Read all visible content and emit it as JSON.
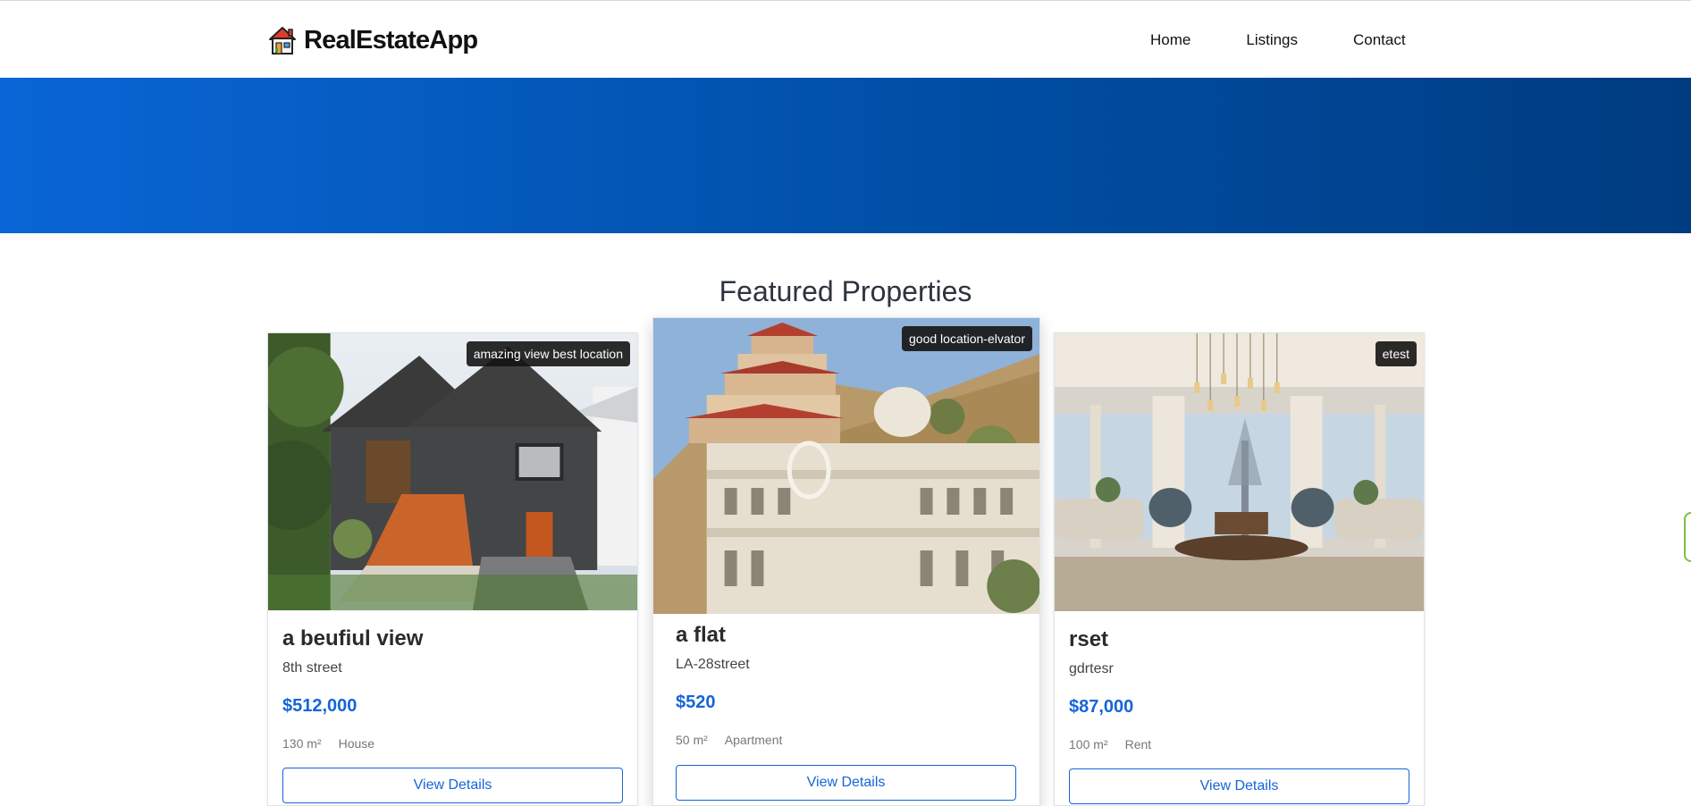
{
  "header": {
    "brand_icon": "house-icon",
    "brand_name": "RealEstateApp",
    "nav": [
      {
        "label": "Home"
      },
      {
        "label": "Listings"
      },
      {
        "label": "Contact"
      }
    ]
  },
  "colors": {
    "primary": "#1565d8",
    "hero_start": "#0a66d6",
    "hero_end": "#003c80"
  },
  "featured": {
    "title": "Featured Properties",
    "properties": [
      {
        "tag": "amazing view best location",
        "title": "a beufiul view",
        "address": "8th street",
        "price": "$512,000",
        "area": "130 m²",
        "type": "House",
        "button": "View Details"
      },
      {
        "tag": "good location-elvator",
        "title": "a flat",
        "address": "LA-28street",
        "price": "$520",
        "area": "50 m²",
        "type": "Apartment",
        "button": "View Details"
      },
      {
        "tag": "etest",
        "title": "rset",
        "address": "gdrtesr",
        "price": "$87,000",
        "area": "100 m²",
        "type": "Rent",
        "button": "View Details"
      }
    ]
  }
}
